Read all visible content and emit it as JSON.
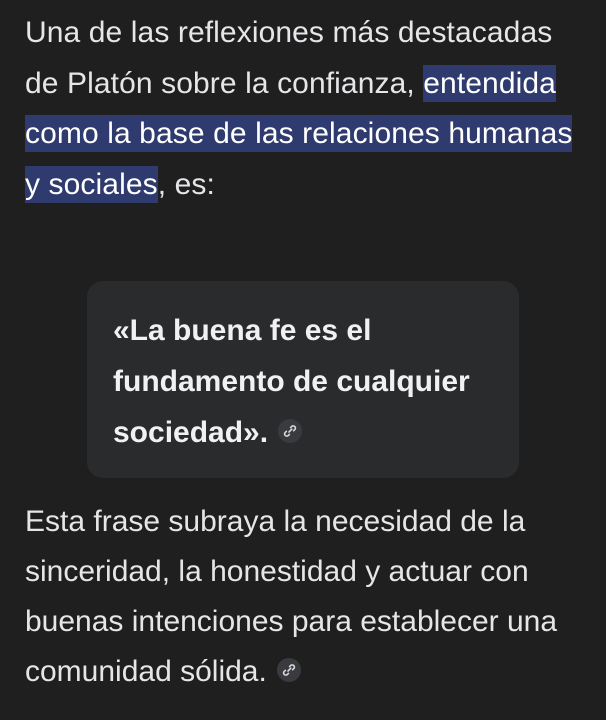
{
  "intro": {
    "before": "Una de las reflexiones más destacadas de Platón sobre la confianza, ",
    "highlighted": "entendida como la base de las relaciones humanas y sociales",
    "after": ", es:"
  },
  "quote": {
    "text": "«La buena fe es el fundamento de cualquier sociedad».",
    "link_icon": "link-icon"
  },
  "explanation": {
    "text": "Esta frase subraya la necesidad de la sinceridad, la honestidad y actuar con buenas intenciones para establecer una comunidad sólida.",
    "link_icon": "link-icon"
  }
}
